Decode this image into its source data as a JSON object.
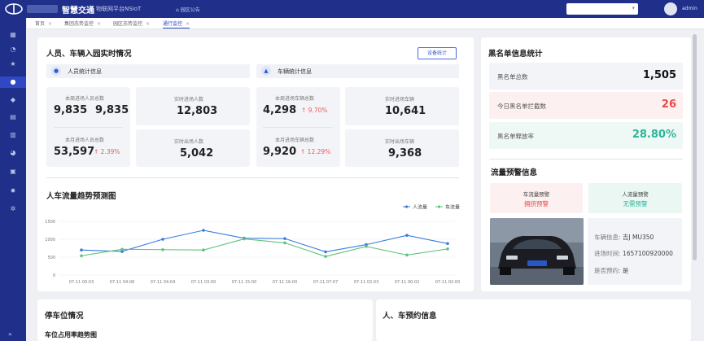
{
  "header": {
    "brand": "智慧交通",
    "brand_sub": "物联网平台NSIoT",
    "notice": "园区公告",
    "user": "admin"
  },
  "sidebar": {
    "items": [
      "dashboard-icon",
      "clock-icon",
      "star-icon",
      "user-icon",
      "bell-icon",
      "document-icon",
      "building-icon",
      "pie-icon",
      "calendar-icon",
      "settings-icon",
      "gear-icon"
    ],
    "active_index": 3
  },
  "tabs": [
    {
      "label": "首页",
      "active": false
    },
    {
      "label": "集团态势监控",
      "active": false
    },
    {
      "label": "园区态势监控",
      "active": false
    },
    {
      "label": "通行监控",
      "active": true
    }
  ],
  "realtime": {
    "title": "人员、车辆入园实时情况",
    "device_button": "设备统计",
    "person_header": "人员统计信息",
    "vehicle_header": "车辆统计信息",
    "week_person_label": "本周进场人员总数",
    "week_person_a": "9,835",
    "week_person_b": "9,835",
    "realtime_in_person_label": "实时进场人数",
    "realtime_in_person": "12,803",
    "month_person_label": "本月进场人员总数",
    "month_person": "53,597",
    "month_person_pct": "2.39%",
    "realtime_out_person_label": "实时出场人数",
    "realtime_out_person": "5,042",
    "week_vehicle_label": "本周进场车辆总数",
    "week_vehicle": "4,298",
    "week_vehicle_pct": "9.70%",
    "realtime_in_vehicle_label": "实时进场车辆",
    "realtime_in_vehicle": "10,641",
    "month_vehicle_label": "本月进场车辆总数",
    "month_vehicle": "9,920",
    "month_vehicle_pct": "12.29%",
    "realtime_out_vehicle_label": "实时出场车辆",
    "realtime_out_vehicle": "9,368"
  },
  "trend": {
    "title": "人车流量趋势预测图"
  },
  "chart_data": {
    "type": "line",
    "x": [
      "07-11 00:03",
      "07-11 04:06",
      "07-11 04:04",
      "07-11 03:00",
      "07-11 15:00",
      "07-11 16:00",
      "07-11 07:07",
      "07-11 02:03",
      "07-11 00:02",
      "07-11 02:00"
    ],
    "series": [
      {
        "name": "人流量",
        "color": "#3a7be0",
        "values": [
          700,
          660,
          1000,
          1250,
          1030,
          1020,
          650,
          850,
          1110,
          880
        ]
      },
      {
        "name": "车流量",
        "color": "#5cc47a",
        "values": [
          540,
          720,
          710,
          700,
          1010,
          900,
          520,
          800,
          560,
          730
        ]
      }
    ],
    "yticks": [
      0,
      500,
      1000,
      1500
    ],
    "ylim": [
      0,
      1500
    ]
  },
  "blacklist": {
    "title": "黑名单信息统计",
    "total_label": "黑名单总数",
    "total": "1,505",
    "today_label": "今日黑名单拦截数",
    "today": "26",
    "rate_label": "黑名单释放率",
    "rate": "28.80%",
    "colors": {
      "today": "#e84a4a",
      "rate": "#2fb39a"
    }
  },
  "traffic_alert": {
    "title": "流量预警信息",
    "vehicle_label": "车流量预警",
    "vehicle_status": "拥挤预警",
    "person_label": "人流量预警",
    "person_status": "无需预警",
    "car_info_label": "车辆信息:",
    "car_info": "吉J MU350",
    "entry_label": "进场时间:",
    "entry": "1657100920000",
    "reserved_label": "是否预约:",
    "reserved": "是"
  },
  "parking": {
    "title": "停车位情况",
    "subtitle": "车位占用率趋势图"
  },
  "reservation": {
    "title": "人、车预约信息"
  }
}
